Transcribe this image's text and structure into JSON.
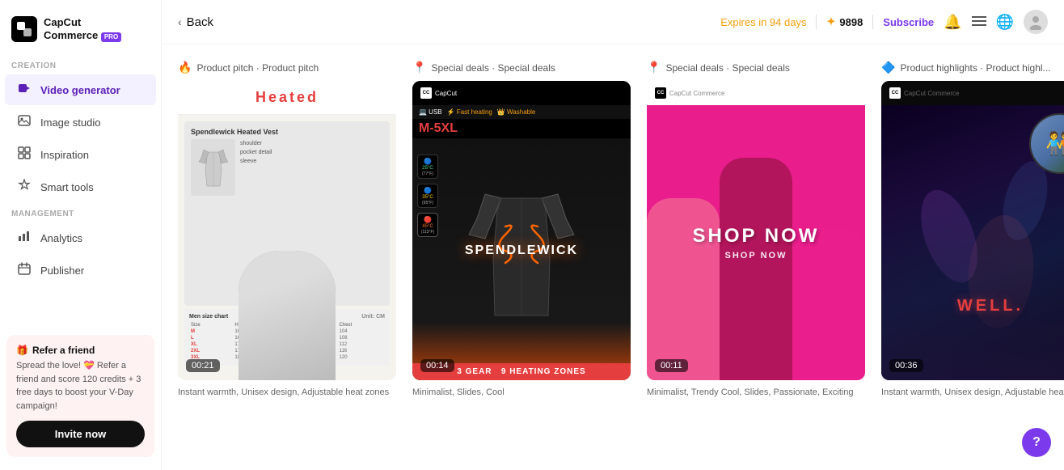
{
  "app": {
    "name": "CapCut",
    "sub": "Commerce",
    "badge": "PRO"
  },
  "sidebar": {
    "sections": [
      {
        "label": "Creation",
        "items": [
          {
            "id": "video-generator",
            "label": "Video generator",
            "icon": "▶",
            "active": true
          },
          {
            "id": "image-studio",
            "label": "Image studio",
            "icon": "🖼",
            "active": false
          },
          {
            "id": "inspiration",
            "label": "Inspiration",
            "icon": "◈",
            "active": false
          },
          {
            "id": "smart-tools",
            "label": "Smart tools",
            "icon": "✦",
            "active": false
          }
        ]
      },
      {
        "label": "Management",
        "items": [
          {
            "id": "analytics",
            "label": "Analytics",
            "icon": "📊",
            "active": false
          },
          {
            "id": "publisher",
            "label": "Publisher",
            "icon": "📅",
            "active": false
          }
        ]
      }
    ],
    "refer": {
      "title": "Refer a friend",
      "icon": "🎁",
      "desc": "Spread the love! 💝 Refer a friend and score 120 credits + 3 free days to boost your V-Day campaign!",
      "button": "Invite now"
    }
  },
  "topbar": {
    "back_label": "Back",
    "expires_label": "Expires in 94 days",
    "credits": "9898",
    "credits_icon": "✦",
    "subscribe_label": "Subscribe"
  },
  "cards": [
    {
      "type_icon": "🔥",
      "type_label": "Product pitch · Product pitch",
      "duration": "00:21",
      "desc": "Instant warmth, Unisex design, Adjustable heat zones"
    },
    {
      "type_icon": "📍",
      "type_label": "Special deals · Special deals",
      "duration": "00:14",
      "desc": "Minimalist, Slides, Cool"
    },
    {
      "type_icon": "📍",
      "type_label": "Special deals · Special deals",
      "duration": "00:11",
      "desc": "Minimalist, Trendy Cool, Slides, Passionate, Exciting"
    },
    {
      "type_icon": "🔷",
      "type_label": "Product highlights · Product highl...",
      "duration": "00:36",
      "desc": "Instant warmth, Unisex design, Adjustable heat zones"
    }
  ]
}
